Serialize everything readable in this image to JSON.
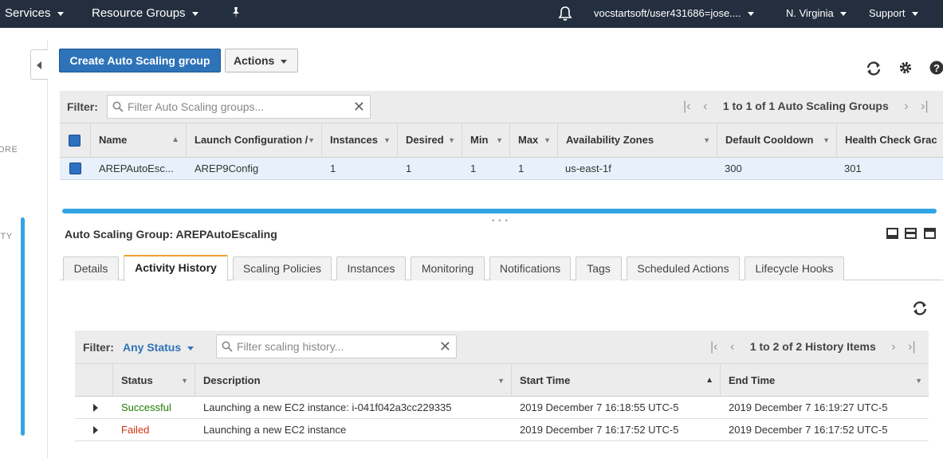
{
  "nav": {
    "services": "Services",
    "resource_groups": "Resource Groups",
    "account": "vocstartsoft/user431686=jose....",
    "region": "N. Virginia",
    "support": "Support"
  },
  "sidebar": {
    "partial_text_1": "ORE",
    "partial_text_2": "ITY"
  },
  "toolbar": {
    "create_label": "Create Auto Scaling group",
    "actions_label": "Actions"
  },
  "asg_filter": {
    "label": "Filter:",
    "placeholder": "Filter Auto Scaling groups...",
    "pager_text": "1 to 1 of 1 Auto Scaling Groups"
  },
  "asg_table": {
    "columns": [
      "Name",
      "Launch Configuration /",
      "Instances",
      "Desired",
      "Min",
      "Max",
      "Availability Zones",
      "Default Cooldown",
      "Health Check Grac"
    ],
    "rows": [
      {
        "name": "AREPAutoEsc...",
        "launch_config": "AREP9Config",
        "instances": "1",
        "desired": "1",
        "min": "1",
        "max": "1",
        "zones": "us-east-1f",
        "cooldown": "300",
        "health_check": "301"
      }
    ]
  },
  "detail": {
    "title": "Auto Scaling Group: AREPAutoEscaling",
    "tabs": [
      "Details",
      "Activity History",
      "Scaling Policies",
      "Instances",
      "Monitoring",
      "Notifications",
      "Tags",
      "Scheduled Actions",
      "Lifecycle Hooks"
    ],
    "active_tab": "Activity History"
  },
  "history_filter": {
    "label": "Filter:",
    "status_value": "Any Status",
    "placeholder": "Filter scaling history...",
    "pager_text": "1 to 2 of 2 History Items"
  },
  "history_table": {
    "columns": [
      "Status",
      "Description",
      "Start Time",
      "End Time"
    ],
    "rows": [
      {
        "status": "Successful",
        "description": "Launching a new EC2 instance: i-041f042a3cc229335",
        "start": "2019 December 7 16:18:55 UTC-5",
        "end": "2019 December 7 16:19:27 UTC-5"
      },
      {
        "status": "Failed",
        "description": "Launching a new EC2 instance",
        "start": "2019 December 7 16:17:52 UTC-5",
        "end": "2019 December 7 16:17:52 UTC-5"
      }
    ]
  },
  "colors": {
    "nav_bg": "#232f3e",
    "primary": "#2e73b8",
    "accent_scroll": "#33a5e5",
    "success": "#1d8102",
    "failed": "#d13212",
    "tab_active": "#f0a02d"
  },
  "icons": [
    "chevron-down-icon",
    "pin-icon",
    "bell-icon",
    "refresh-icon",
    "gear-icon",
    "help-icon",
    "search-icon",
    "clear-icon",
    "first-page-icon",
    "prev-page-icon",
    "next-page-icon",
    "last-page-icon",
    "sort-icon",
    "expand-icon",
    "layout-icon"
  ]
}
